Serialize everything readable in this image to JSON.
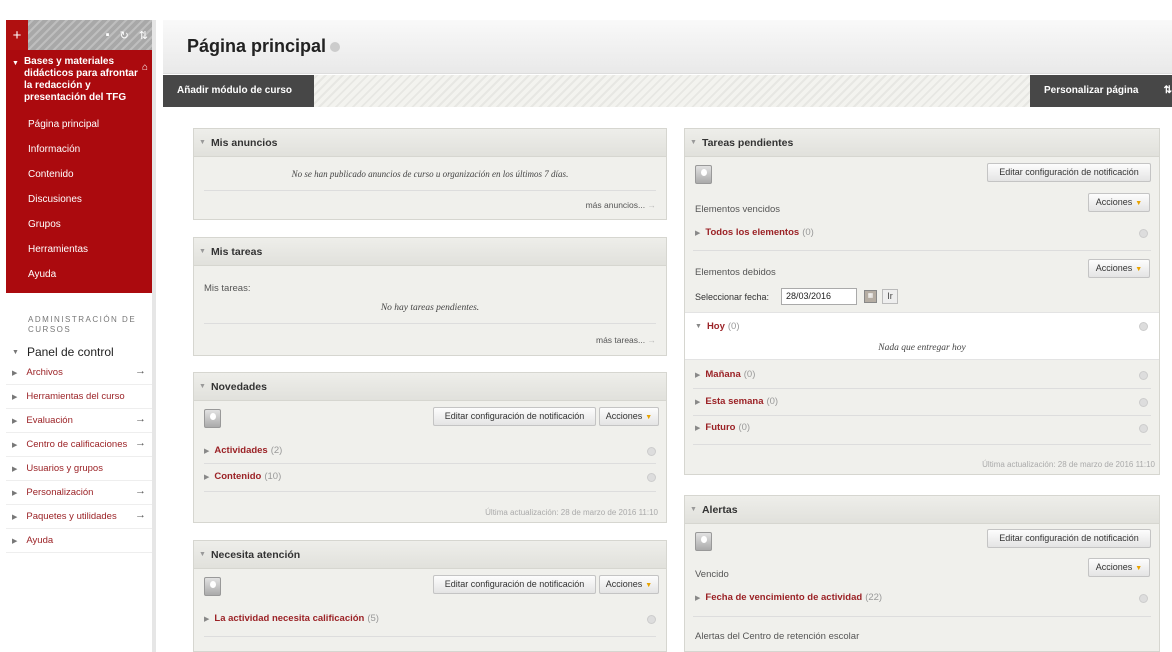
{
  "sidebar": {
    "plus": "+",
    "tools": [
      "▪",
      "↻",
      "⇅"
    ],
    "course_title": "Bases y materiales didácticos para afrontar la redacción y presentación del TFG",
    "links": [
      "Página principal",
      "Información",
      "Contenido",
      "Discusiones",
      "Grupos",
      "Herramientas",
      "Ayuda"
    ],
    "admin_heading": "ADMINISTRACIÓN DE CURSOS",
    "panel": "Panel de control",
    "items": [
      {
        "label": "Archivos",
        "arrow": true
      },
      {
        "label": "Herramientas del curso",
        "arrow": false
      },
      {
        "label": "Evaluación",
        "arrow": true
      },
      {
        "label": "Centro de calificaciones",
        "arrow": true
      },
      {
        "label": "Usuarios y grupos",
        "arrow": false
      },
      {
        "label": "Personalización",
        "arrow": true
      },
      {
        "label": "Paquetes y utilidades",
        "arrow": true
      },
      {
        "label": "Ayuda",
        "arrow": false
      }
    ]
  },
  "header": {
    "title": "Página principal"
  },
  "actionbar": {
    "add_label": "Añadir módulo de curso",
    "personalize_label": "Personalizar página",
    "sort": "⇅"
  },
  "anuncios": {
    "title": "Mis anuncios",
    "empty": "No se han publicado anuncios de curso u organización en los últimos 7 días.",
    "more": "más anuncios..."
  },
  "tareas": {
    "title": "Mis tareas",
    "label": "Mis tareas:",
    "empty": "No hay tareas pendientes.",
    "more": "más tareas..."
  },
  "novedades": {
    "title": "Novedades",
    "edit_btn": "Editar configuración de notificación",
    "actions_btn": "Acciones",
    "rows": [
      {
        "label": "Actividades",
        "count": "(2)"
      },
      {
        "label": "Contenido",
        "count": "(10)"
      }
    ],
    "updated": "Última actualización: 28 de marzo de 2016 11:10"
  },
  "atencion": {
    "title": "Necesita atención",
    "edit_btn": "Editar configuración de notificación",
    "actions_btn": "Acciones",
    "row": {
      "label": "La actividad necesita calificación",
      "count": "(5)"
    }
  },
  "pendientes": {
    "title": "Tareas pendientes",
    "edit_btn": "Editar configuración de notificación",
    "vencidos_label": "Elementos vencidos",
    "actions_btn": "Acciones",
    "todos": {
      "label": "Todos los elementos",
      "count": "(0)"
    },
    "debidos_label": "Elementos debidos",
    "date_label": "Seleccionar fecha:",
    "date_value": "28/03/2016",
    "go_btn": "Ir",
    "hoy": {
      "label": "Hoy",
      "count": "(0)"
    },
    "hoy_empty": "Nada que entregar hoy",
    "rows": [
      {
        "label": "Mañana",
        "count": "(0)"
      },
      {
        "label": "Esta semana",
        "count": "(0)"
      },
      {
        "label": "Futuro",
        "count": "(0)"
      }
    ],
    "updated": "Última actualización: 28 de marzo de 2016 11:10"
  },
  "alertas": {
    "title": "Alertas",
    "edit_btn": "Editar configuración de notificación",
    "vencido_label": "Vencido",
    "actions_btn": "Acciones",
    "row": {
      "label": "Fecha de vencimiento de actividad",
      "count": "(22)"
    },
    "retention_label": "Alertas del Centro de retención escolar"
  }
}
